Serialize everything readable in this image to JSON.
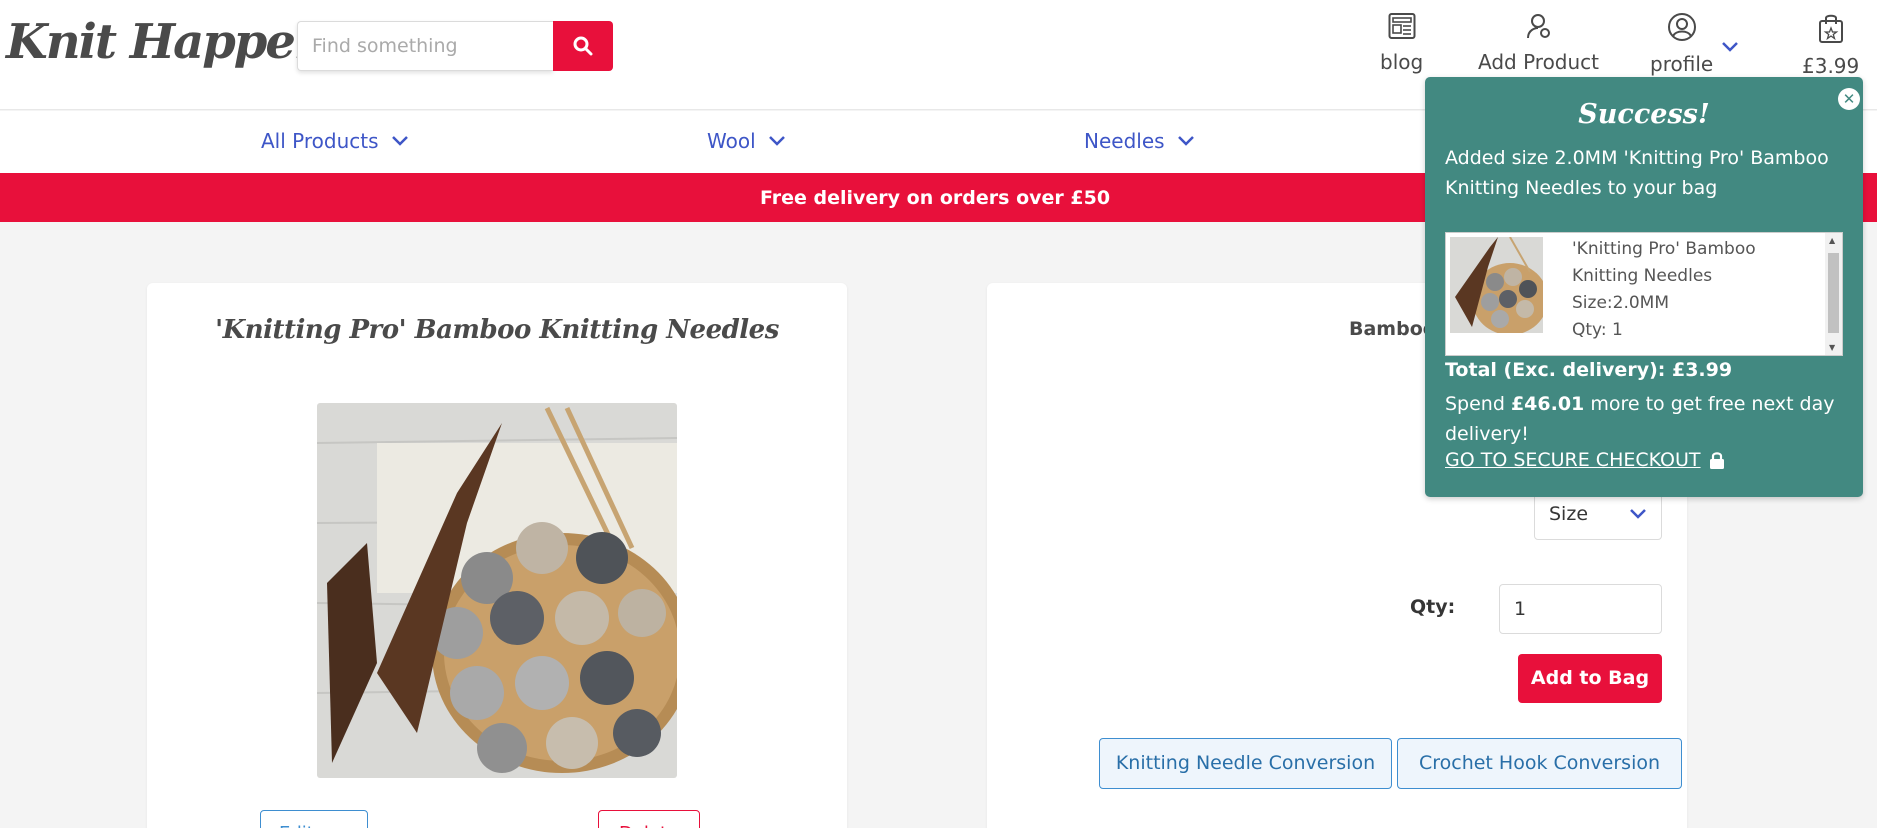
{
  "header": {
    "logo": "Knit Happens",
    "search_placeholder": "Find something",
    "nav": {
      "blog": "blog",
      "add_product": "Add Product",
      "profile": "profile",
      "bag_total": "£3.99"
    }
  },
  "categories": [
    {
      "label": "All Products"
    },
    {
      "label": "Wool"
    },
    {
      "label": "Needles"
    }
  ],
  "banner": "Free delivery on orders over £50",
  "product": {
    "title": "'Knitting Pro' Bamboo Knitting Needles",
    "edit_label": "Edit",
    "delete_label": "Delete"
  },
  "details": {
    "bamboo_label": "Bamboo",
    "size_placeholder": "Size",
    "qty_label": "Qty:",
    "qty_value": "1",
    "add_to_bag": "Add to Bag",
    "conversion_buttons": [
      "Knitting Needle Conversion",
      "Crochet Hook Conversion"
    ]
  },
  "toast": {
    "title": "Success!",
    "message": "Added size 2.0MM 'Knitting Pro' Bamboo Knitting Needles to your bag",
    "item": {
      "name_line1": "'Knitting Pro' Bamboo",
      "name_line2": "Knitting Needles",
      "size": "Size:2.0MM",
      "qty": "Qty: 1"
    },
    "total": "Total (Exc. delivery): £3.99",
    "spend_prefix": "Spend ",
    "spend_amount": "£46.01",
    "spend_suffix": " more to get free next day delivery!",
    "checkout": "GO TO SECURE CHECKOUT"
  },
  "colors": {
    "brand_red": "#e8103b",
    "nav_blue": "#3e56c7",
    "toast_teal": "#428981",
    "info_blue": "#3e8ed0"
  }
}
